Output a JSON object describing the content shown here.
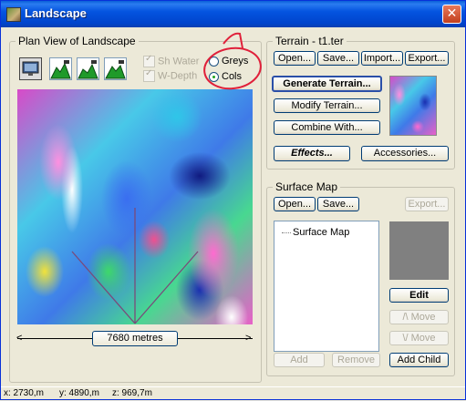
{
  "window": {
    "title": "Landscape",
    "close_label": "✕"
  },
  "plan_view": {
    "legend": "Plan View of Landscape",
    "view_icons": [
      "monitor-view-icon",
      "terrain-view-1-icon",
      "terrain-view-2-icon",
      "terrain-view-3-icon"
    ],
    "checkboxes": [
      {
        "label": "Sh Water",
        "checked": true,
        "enabled": false
      },
      {
        "label": "W-Depth",
        "checked": true,
        "enabled": false
      }
    ],
    "radios": [
      {
        "label": "Greys",
        "selected": false
      },
      {
        "label": "Cols",
        "selected": true
      }
    ],
    "scale_label": "7680 metres"
  },
  "terrain": {
    "legend": "Terrain - t1.ter",
    "open": "Open...",
    "save": "Save...",
    "import": "Import...",
    "export": "Export...",
    "generate": "Generate Terrain...",
    "modify": "Modify Terrain...",
    "combine": "Combine With...",
    "effects": "Effects...",
    "accessories": "Accessories..."
  },
  "surface_map": {
    "legend": "Surface Map",
    "open": "Open...",
    "save": "Save...",
    "export": "Export...",
    "tree_item": "Surface Map",
    "edit": "Edit",
    "move_up": "/\\ Move",
    "move_down": "\\/ Move",
    "add": "Add",
    "remove": "Remove",
    "add_child": "Add Child"
  },
  "status": {
    "x": "x: 2730,m",
    "y": "y: 4890,m",
    "z": "z: 969,7m"
  },
  "annotation": {
    "number": "1",
    "color": "#e0203a"
  },
  "colors": {
    "title_bar": "#0454e0",
    "dialog_bg": "#ece9d8",
    "annotation": "#e0203a"
  }
}
